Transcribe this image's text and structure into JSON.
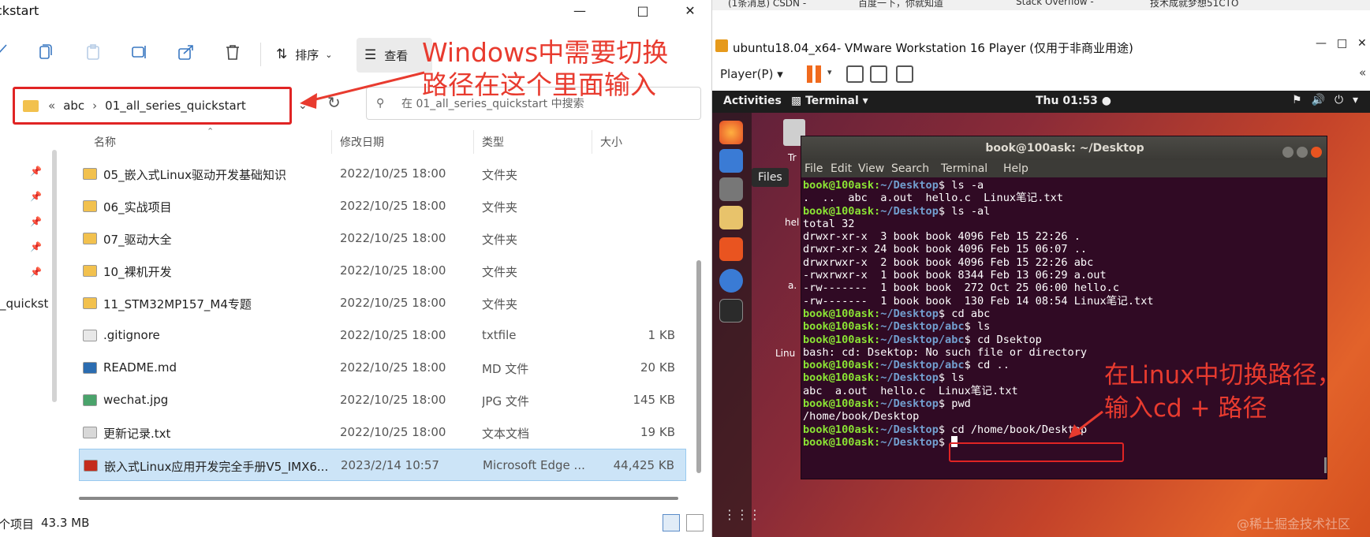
{
  "explorer": {
    "title": "ckstart",
    "toolbar": {
      "sort_label": "排序",
      "view_label": "查看"
    },
    "address": {
      "part1": "abc",
      "part2": "01_all_series_quickstart"
    },
    "search": {
      "placeholder": "在 01_all_series_quickstart 中搜索"
    },
    "columns": [
      "名称",
      "修改日期",
      "类型",
      "大小"
    ],
    "nav_quick_label": "_quickst",
    "rows": [
      {
        "name": "05_嵌入式Linux驱动开发基础知识",
        "date": "2022/10/25 18:00",
        "type": "文件夹",
        "size": "",
        "icon": "folder-icon"
      },
      {
        "name": "06_实战项目",
        "date": "2022/10/25 18:00",
        "type": "文件夹",
        "size": "",
        "icon": "folder-icon"
      },
      {
        "name": "07_驱动大全",
        "date": "2022/10/25 18:00",
        "type": "文件夹",
        "size": "",
        "icon": "folder-icon"
      },
      {
        "name": "10_裸机开发",
        "date": "2022/10/25 18:00",
        "type": "文件夹",
        "size": "",
        "icon": "folder-icon"
      },
      {
        "name": "11_STM32MP157_M4专题",
        "date": "2022/10/25 18:00",
        "type": "文件夹",
        "size": "",
        "icon": "folder-icon"
      },
      {
        "name": ".gitignore",
        "date": "2022/10/25 18:00",
        "type": "txtfile",
        "size": "1 KB",
        "icon": "file-icon"
      },
      {
        "name": "README.md",
        "date": "2022/10/25 18:00",
        "type": "MD 文件",
        "size": "20 KB",
        "icon": "markdown-file-icon"
      },
      {
        "name": "wechat.jpg",
        "date": "2022/10/25 18:00",
        "type": "JPG 文件",
        "size": "145 KB",
        "icon": "image-file-icon"
      },
      {
        "name": "更新记录.txt",
        "date": "2022/10/25 18:00",
        "type": "文本文档",
        "size": "19 KB",
        "icon": "text-file-icon"
      },
      {
        "name": "嵌入式Linux应用开发完全手册V5_IMX6...",
        "date": "2023/2/14 10:57",
        "type": "Microsoft Edge ...",
        "size": "44,425 KB",
        "icon": "pdf-file-icon",
        "selected": true
      }
    ],
    "status": {
      "items": "个项目",
      "selected_size": "43.3 MB"
    }
  },
  "annotation_windows": {
    "line1": "Windows中需要切换",
    "line2": "路径在这个里面输入"
  },
  "annotation_linux": {
    "line1": "在Linux中切换路径，",
    "line2": "输入cd + 路径"
  },
  "vmware": {
    "title": "ubuntu18.04_x64- VMware Workstation 16 Player (仅用于非商业用途)",
    "player_menu": "Player(P)"
  },
  "ubuntu": {
    "activities": "Activities",
    "app_menu": "Terminal",
    "clock": "Thu 01:53",
    "files_tooltip": "Files",
    "desktop_labels": {
      "trash": "Tr",
      "hello": "hel",
      "aout": "a.",
      "linux": "Linu"
    }
  },
  "terminal": {
    "title": "book@100ask: ~/Desktop",
    "menu": [
      "File",
      "Edit",
      "View",
      "Search",
      "Terminal",
      "Help"
    ],
    "user": "book@100ask",
    "lines": [
      {
        "path": "~/Desktop",
        "cmd": "ls -a"
      },
      {
        "out": ".  ..  abc  a.out  hello.c  Linux笔记.txt"
      },
      {
        "path": "~/Desktop",
        "cmd": "ls -al"
      },
      {
        "out": "total 32"
      },
      {
        "out": "drwxr-xr-x  3 book book 4096 Feb 15 22:26 ."
      },
      {
        "out": "drwxr-xr-x 24 book book 4096 Feb 15 06:07 .."
      },
      {
        "out": "drwxrwxr-x  2 book book 4096 Feb 15 22:26 abc"
      },
      {
        "out": "-rwxrwxr-x  1 book book 8344 Feb 13 06:29 a.out"
      },
      {
        "out": "-rw-------  1 book book  272 Oct 25 06:00 hello.c"
      },
      {
        "out": "-rw-------  1 book book  130 Feb 14 08:54 Linux笔记.txt"
      },
      {
        "path": "~/Desktop",
        "cmd": "cd abc"
      },
      {
        "path": "~/Desktop/abc",
        "cmd": "ls"
      },
      {
        "path": "~/Desktop/abc",
        "cmd": "cd Dsektop"
      },
      {
        "out": "bash: cd: Dsektop: No such file or directory"
      },
      {
        "path": "~/Desktop/abc",
        "cmd": "cd .."
      },
      {
        "path": "~/Desktop",
        "cmd": "ls"
      },
      {
        "out": "abc  a.out  hello.c  Linux笔记.txt"
      },
      {
        "path": "~/Desktop",
        "cmd": "pwd"
      },
      {
        "out": "/home/book/Desktop"
      },
      {
        "path": "~/Desktop",
        "cmd": "cd /home/book/Desktop"
      },
      {
        "path": "~/Desktop",
        "cmd": ""
      }
    ]
  },
  "browser_tabs": [
    "(1条消息) CSDN -",
    "百度一下，你就知道",
    "Stack Overflow -",
    "技术成就梦想51CTO"
  ],
  "watermark": "@稀土掘金技术社区",
  "colors": {
    "annotation_red": "#e83b2f",
    "highlight_box": "#e02424",
    "terminal_bg": "#300a24",
    "prompt_green": "#8ae234",
    "path_blue": "#729fcf",
    "ubuntu_orange": "#e95420"
  }
}
